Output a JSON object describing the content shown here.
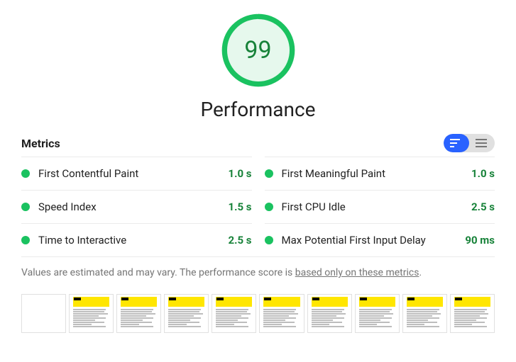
{
  "score": "99",
  "category": "Performance",
  "metrics_title": "Metrics",
  "metrics": [
    {
      "name": "First Contentful Paint",
      "value": "1.0 s"
    },
    {
      "name": "First Meaningful Paint",
      "value": "1.0 s"
    },
    {
      "name": "Speed Index",
      "value": "1.5 s"
    },
    {
      "name": "First CPU Idle",
      "value": "2.5 s"
    },
    {
      "name": "Time to Interactive",
      "value": "2.5 s"
    },
    {
      "name": "Max Potential First Input Delay",
      "value": "90 ms"
    }
  ],
  "disclaimer_prefix": "Values are estimated and may vary. The performance score is ",
  "disclaimer_link": "based only on these metrics",
  "disclaimer_suffix": "."
}
